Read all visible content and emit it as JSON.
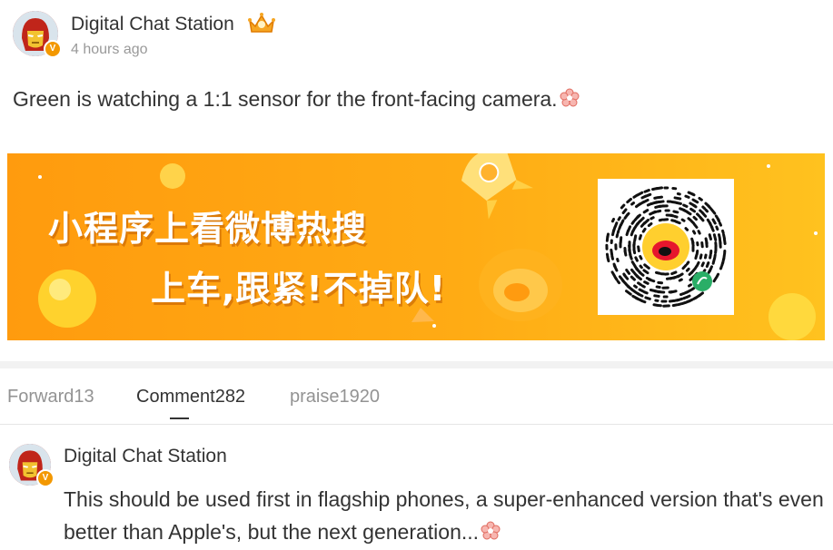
{
  "post": {
    "author": "Digital Chat Station",
    "time": "4 hours ago",
    "verified_badge": "V",
    "text": "Green is watching a 1:1 sensor for the front-facing camera.",
    "avatar_icon": "iron-man-avatar-icon",
    "author_badge_icon": "crown-icon",
    "emoji_icon": "flower-emoji-icon"
  },
  "banner": {
    "line1": "小程序上看微博热搜",
    "line2": "上车,跟紧!不掉队!",
    "qr_icon": "weibo-mini-program-qr-icon",
    "colors": {
      "start": "#ff9b0e",
      "end": "#ffc21f"
    }
  },
  "tabs": [
    {
      "label": "Forward13"
    },
    {
      "label": "Comment282",
      "active": true
    },
    {
      "label": "praise1920"
    }
  ],
  "comment": {
    "author": "Digital Chat Station",
    "verified_badge": "V",
    "text": "This should be used first in flagship phones, a super-enhanced version that's even better than Apple's, but the next generation...",
    "avatar_icon": "iron-man-avatar-icon"
  },
  "colors": {
    "text": "#333333",
    "muted": "#939393",
    "verified": "#f39800"
  }
}
